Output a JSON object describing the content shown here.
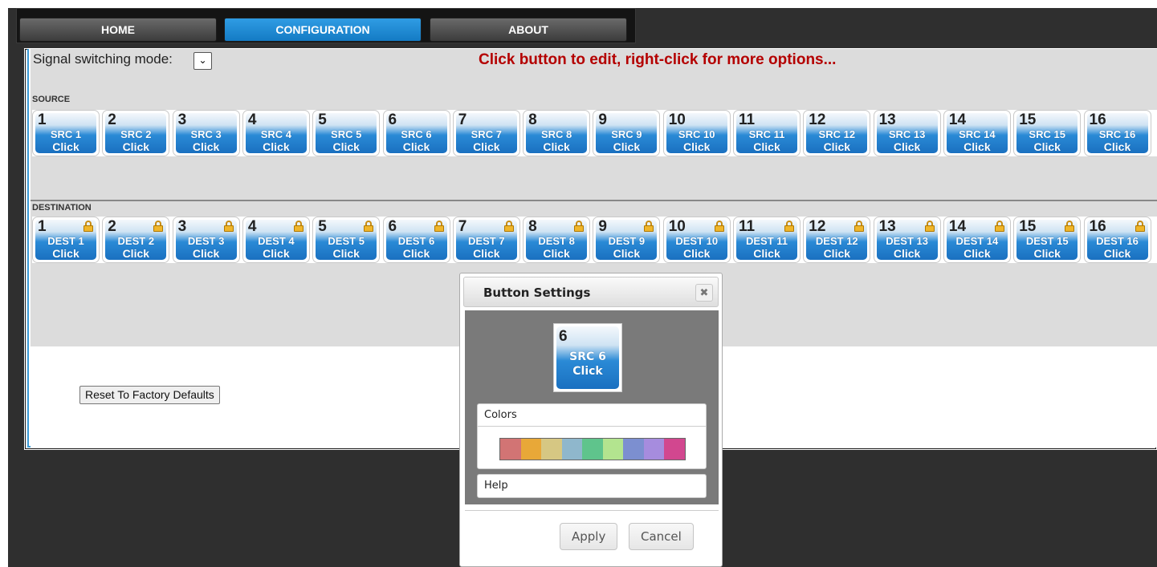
{
  "nav": {
    "tabs": [
      {
        "label": "HOME",
        "active": false
      },
      {
        "label": "CONFIGURATION",
        "active": true
      },
      {
        "label": "ABOUT",
        "active": false
      }
    ]
  },
  "toolbar": {
    "mode_label": "Signal switching mode:",
    "mode_select_icon": "chevron-down-icon",
    "hint": "Click button to edit, right-click for more options..."
  },
  "source": {
    "label": "SOURCE",
    "buttons": [
      {
        "num": "1",
        "name": "SRC 1",
        "action": "Click"
      },
      {
        "num": "2",
        "name": "SRC 2",
        "action": "Click"
      },
      {
        "num": "3",
        "name": "SRC 3",
        "action": "Click"
      },
      {
        "num": "4",
        "name": "SRC 4",
        "action": "Click"
      },
      {
        "num": "5",
        "name": "SRC 5",
        "action": "Click"
      },
      {
        "num": "6",
        "name": "SRC 6",
        "action": "Click"
      },
      {
        "num": "7",
        "name": "SRC 7",
        "action": "Click"
      },
      {
        "num": "8",
        "name": "SRC 8",
        "action": "Click"
      },
      {
        "num": "9",
        "name": "SRC 9",
        "action": "Click"
      },
      {
        "num": "10",
        "name": "SRC 10",
        "action": "Click"
      },
      {
        "num": "11",
        "name": "SRC 11",
        "action": "Click"
      },
      {
        "num": "12",
        "name": "SRC 12",
        "action": "Click"
      },
      {
        "num": "13",
        "name": "SRC 13",
        "action": "Click"
      },
      {
        "num": "14",
        "name": "SRC 14",
        "action": "Click"
      },
      {
        "num": "15",
        "name": "SRC 15",
        "action": "Click"
      },
      {
        "num": "16",
        "name": "SRC 16",
        "action": "Click"
      }
    ]
  },
  "destination": {
    "label": "DESTINATION",
    "buttons": [
      {
        "num": "1",
        "name": "DEST 1",
        "action": "Click"
      },
      {
        "num": "2",
        "name": "DEST 2",
        "action": "Click"
      },
      {
        "num": "3",
        "name": "DEST 3",
        "action": "Click"
      },
      {
        "num": "4",
        "name": "DEST 4",
        "action": "Click"
      },
      {
        "num": "5",
        "name": "DEST 5",
        "action": "Click"
      },
      {
        "num": "6",
        "name": "DEST 6",
        "action": "Click"
      },
      {
        "num": "7",
        "name": "DEST 7",
        "action": "Click"
      },
      {
        "num": "8",
        "name": "DEST 8",
        "action": "Click"
      },
      {
        "num": "9",
        "name": "DEST 9",
        "action": "Click"
      },
      {
        "num": "10",
        "name": "DEST 10",
        "action": "Click"
      },
      {
        "num": "11",
        "name": "DEST 11",
        "action": "Click"
      },
      {
        "num": "12",
        "name": "DEST 12",
        "action": "Click"
      },
      {
        "num": "13",
        "name": "DEST 13",
        "action": "Click"
      },
      {
        "num": "14",
        "name": "DEST 14",
        "action": "Click"
      },
      {
        "num": "15",
        "name": "DEST 15",
        "action": "Click"
      },
      {
        "num": "16",
        "name": "DEST 16",
        "action": "Click"
      }
    ],
    "lock_icon": "lock-icon"
  },
  "reset_label": "Reset To Factory Defaults",
  "dialog": {
    "title": "Button Settings",
    "close_icon": "close-icon",
    "preview": {
      "num": "6",
      "name": "SRC 6",
      "action": "Click"
    },
    "colors_label": "Colors",
    "colors": [
      "#d27474",
      "#e8a838",
      "#d6c783",
      "#8fb7cc",
      "#5fc48c",
      "#b3e48f",
      "#7c8fd0",
      "#a68cde",
      "#d2478f"
    ],
    "help_label": "Help",
    "apply_label": "Apply",
    "cancel_label": "Cancel"
  },
  "theme": {
    "accent": "#1a7fd0",
    "hint_color": "#b40000"
  }
}
